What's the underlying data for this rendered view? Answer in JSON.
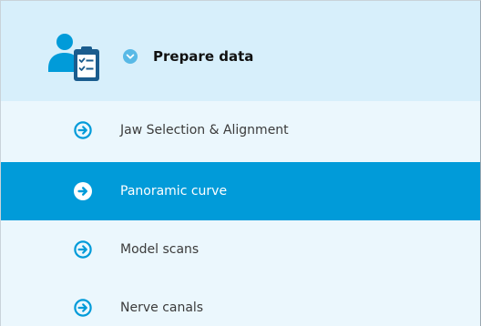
{
  "colors": {
    "panel_background": "#ebf7fd",
    "header_background": "#d7effb",
    "accent": "#019bd9",
    "brand_dark": "#1a5c8e",
    "text": "#3b3b3b",
    "active_text": "#ffffff"
  },
  "header": {
    "icon": "patient-checklist-icon",
    "collapse_icon": "chevron-down-circle-icon",
    "title": "Prepare data"
  },
  "steps": [
    {
      "label": "Jaw Selection & Alignment",
      "icon": "arrow-right-circle-icon",
      "active": false
    },
    {
      "label": "Panoramic curve",
      "icon": "arrow-right-circle-icon",
      "active": true
    },
    {
      "label": "Model scans",
      "icon": "arrow-right-circle-icon",
      "active": false
    },
    {
      "label": "Nerve canals",
      "icon": "arrow-right-circle-icon",
      "active": false
    }
  ]
}
